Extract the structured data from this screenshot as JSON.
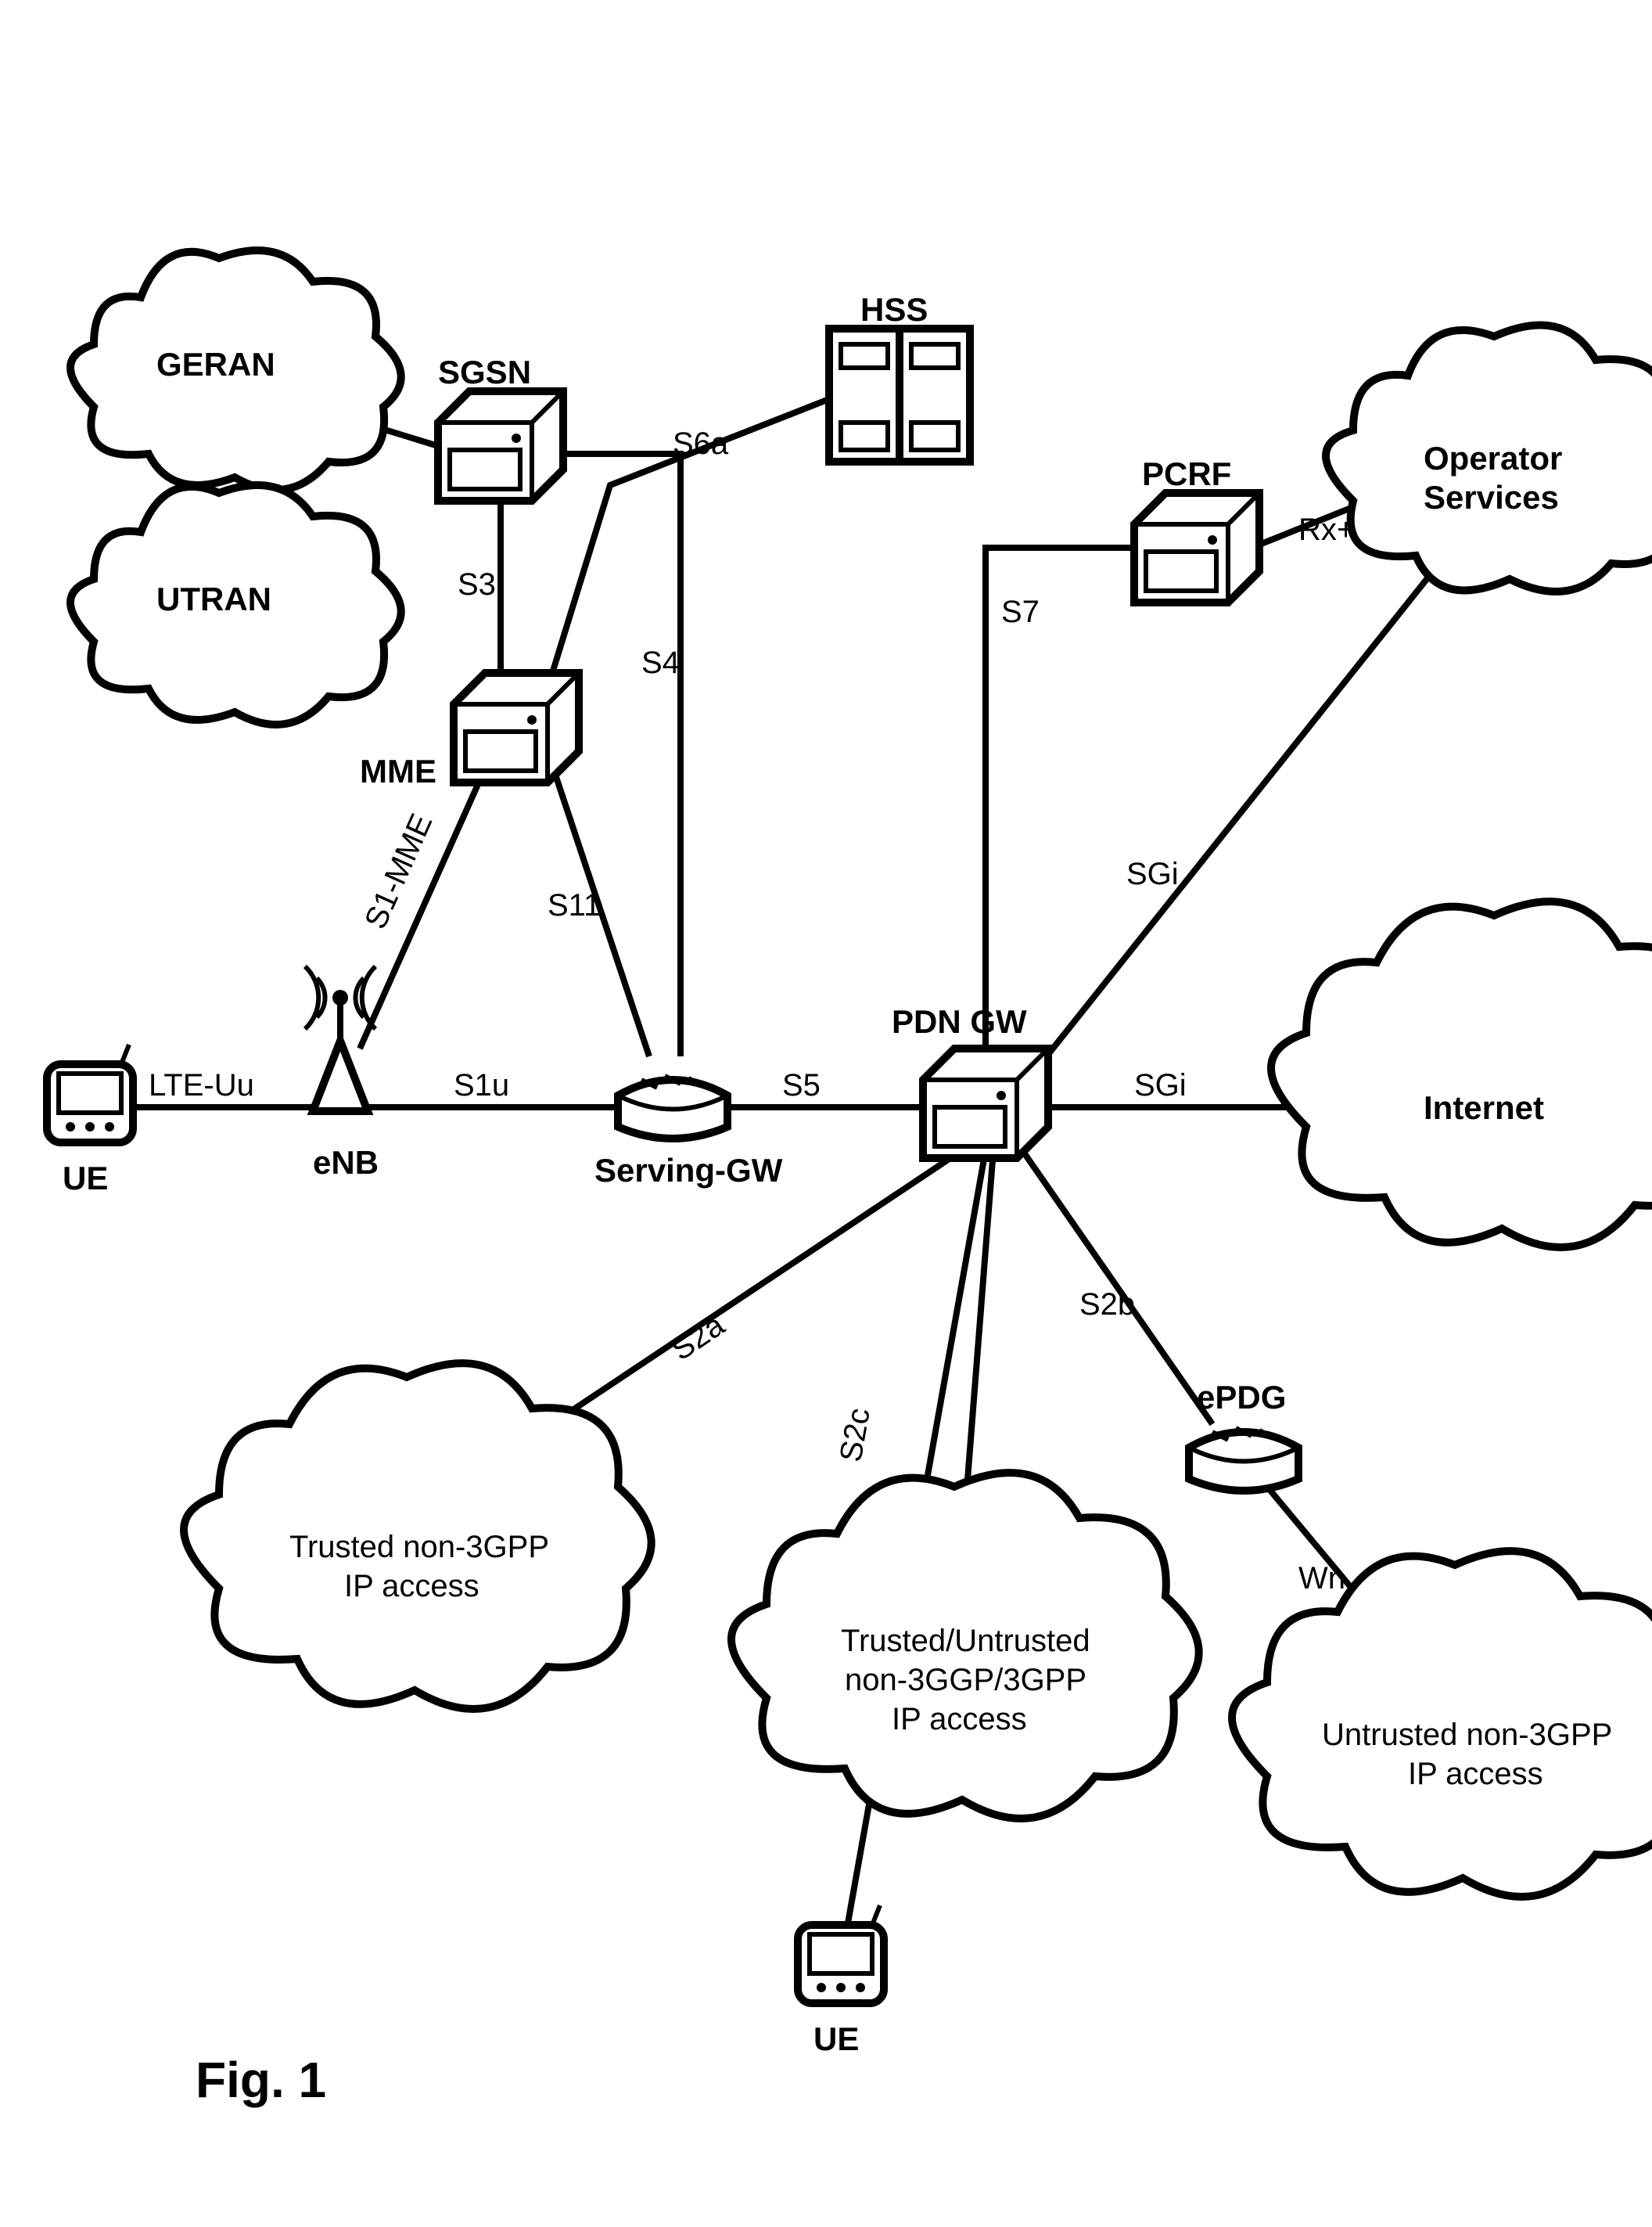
{
  "figure_label": "Fig. 1",
  "nodes": {
    "geran": "GERAN",
    "utran": "UTRAN",
    "sgsn": "SGSN",
    "hss": "HSS",
    "mme": "MME",
    "pcrf": "PCRF",
    "operator_services": "Operator",
    "operator_services2": "Services",
    "enb": "eNB",
    "serving_gw": "Serving-GW",
    "pdn_gw": "PDN GW",
    "epdg": "ePDG",
    "internet": "Internet",
    "ue_left": "UE",
    "ue_right": "UE",
    "trusted_non3gpp_l1": "Trusted non-3GPP",
    "trusted_non3gpp_l2": "IP access",
    "trusted_untrusted_l1": "Trusted/Untrusted",
    "trusted_untrusted_l2": "non-3GGP/3GPP",
    "trusted_untrusted_l3": "IP access",
    "untrusted_non3gpp_l1": "Untrusted non-3GPP",
    "untrusted_non3gpp_l2": "IP access"
  },
  "edges": {
    "lte_uu": "LTE-Uu",
    "s1_mme": "S1-MME",
    "s1u": "S1u",
    "s3": "S3",
    "s4": "S4",
    "s5": "S5",
    "s6a": "S6a",
    "s7": "S7",
    "s11": "S11",
    "s2a": "S2a",
    "s2b": "S2b",
    "s2c": "S2c",
    "sgi_internet": "SGi",
    "sgi_operator": "SGi",
    "rx_plus": "Rx+",
    "wn": "Wn"
  }
}
